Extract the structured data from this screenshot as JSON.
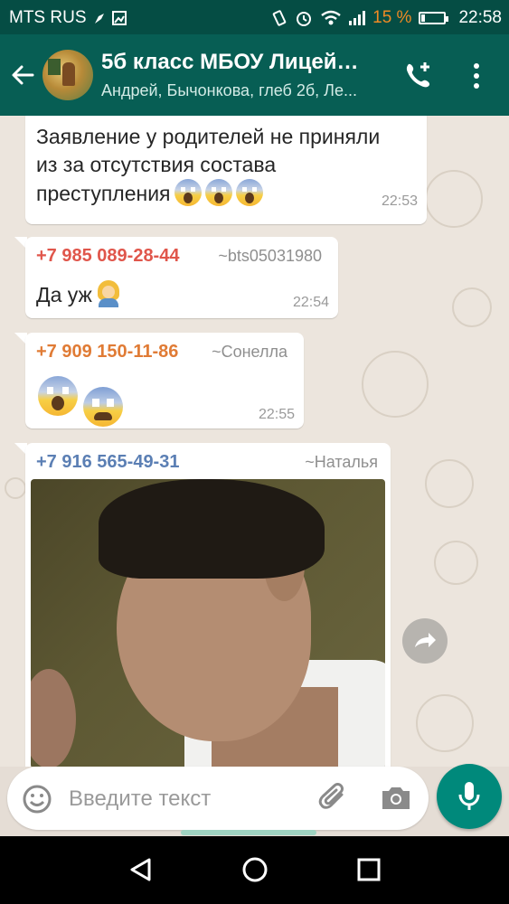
{
  "status_bar": {
    "carrier": "MTS RUS",
    "battery_percent": "15 %",
    "battery_level": 0.15,
    "time": "22:58"
  },
  "header": {
    "title": "5б класс МБОУ Лицей…",
    "subtitle": "Андрей, Бычонкова, глеб 2б, Ле..."
  },
  "messages": [
    {
      "text_line1": "Заявление у родителей не приняли",
      "text_line2": "из за отсутствия состава",
      "text_line3": "преступления",
      "time": "22:53"
    },
    {
      "sender": "+7 985 089-28-44",
      "sender_color": "#e0564b",
      "alias": "~bts05031980",
      "text": "Да уж",
      "time": "22:54"
    },
    {
      "sender": "+7 909 150-11-86",
      "sender_color": "#e07b35",
      "alias": "~Сонелла",
      "time": "22:55"
    },
    {
      "sender": "+7 916 565-49-31",
      "sender_color": "#5b7fb4",
      "alias": "~Наталья"
    }
  ],
  "composer": {
    "placeholder": "Введите текст"
  },
  "icons": {
    "back": "arrow-left-icon",
    "add_call": "phone-plus-icon",
    "menu": "more-vert-icon",
    "emoji": "smiley-icon",
    "attach": "paperclip-icon",
    "camera": "camera-icon",
    "mic": "microphone-icon",
    "forward": "share-forward-icon"
  },
  "colors": {
    "header": "#075e54",
    "status": "#054d44",
    "accent": "#00897b"
  }
}
